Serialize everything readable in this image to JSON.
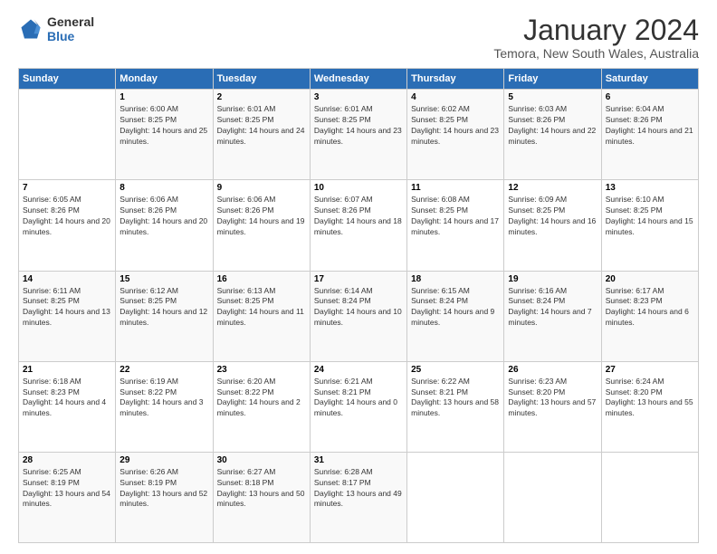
{
  "logo": {
    "general": "General",
    "blue": "Blue"
  },
  "title": "January 2024",
  "location": "Temora, New South Wales, Australia",
  "days_of_week": [
    "Sunday",
    "Monday",
    "Tuesday",
    "Wednesday",
    "Thursday",
    "Friday",
    "Saturday"
  ],
  "weeks": [
    [
      {
        "day": "",
        "empty": true
      },
      {
        "day": "1",
        "sunrise": "6:00 AM",
        "sunset": "8:25 PM",
        "daylight": "14 hours and 25 minutes."
      },
      {
        "day": "2",
        "sunrise": "6:01 AM",
        "sunset": "8:25 PM",
        "daylight": "14 hours and 24 minutes."
      },
      {
        "day": "3",
        "sunrise": "6:01 AM",
        "sunset": "8:25 PM",
        "daylight": "14 hours and 23 minutes."
      },
      {
        "day": "4",
        "sunrise": "6:02 AM",
        "sunset": "8:25 PM",
        "daylight": "14 hours and 23 minutes."
      },
      {
        "day": "5",
        "sunrise": "6:03 AM",
        "sunset": "8:26 PM",
        "daylight": "14 hours and 22 minutes."
      },
      {
        "day": "6",
        "sunrise": "6:04 AM",
        "sunset": "8:26 PM",
        "daylight": "14 hours and 21 minutes."
      }
    ],
    [
      {
        "day": "7",
        "sunrise": "6:05 AM",
        "sunset": "8:26 PM",
        "daylight": "14 hours and 20 minutes."
      },
      {
        "day": "8",
        "sunrise": "6:06 AM",
        "sunset": "8:26 PM",
        "daylight": "14 hours and 20 minutes."
      },
      {
        "day": "9",
        "sunrise": "6:06 AM",
        "sunset": "8:26 PM",
        "daylight": "14 hours and 19 minutes."
      },
      {
        "day": "10",
        "sunrise": "6:07 AM",
        "sunset": "8:26 PM",
        "daylight": "14 hours and 18 minutes."
      },
      {
        "day": "11",
        "sunrise": "6:08 AM",
        "sunset": "8:25 PM",
        "daylight": "14 hours and 17 minutes."
      },
      {
        "day": "12",
        "sunrise": "6:09 AM",
        "sunset": "8:25 PM",
        "daylight": "14 hours and 16 minutes."
      },
      {
        "day": "13",
        "sunrise": "6:10 AM",
        "sunset": "8:25 PM",
        "daylight": "14 hours and 15 minutes."
      }
    ],
    [
      {
        "day": "14",
        "sunrise": "6:11 AM",
        "sunset": "8:25 PM",
        "daylight": "14 hours and 13 minutes."
      },
      {
        "day": "15",
        "sunrise": "6:12 AM",
        "sunset": "8:25 PM",
        "daylight": "14 hours and 12 minutes."
      },
      {
        "day": "16",
        "sunrise": "6:13 AM",
        "sunset": "8:25 PM",
        "daylight": "14 hours and 11 minutes."
      },
      {
        "day": "17",
        "sunrise": "6:14 AM",
        "sunset": "8:24 PM",
        "daylight": "14 hours and 10 minutes."
      },
      {
        "day": "18",
        "sunrise": "6:15 AM",
        "sunset": "8:24 PM",
        "daylight": "14 hours and 9 minutes."
      },
      {
        "day": "19",
        "sunrise": "6:16 AM",
        "sunset": "8:24 PM",
        "daylight": "14 hours and 7 minutes."
      },
      {
        "day": "20",
        "sunrise": "6:17 AM",
        "sunset": "8:23 PM",
        "daylight": "14 hours and 6 minutes."
      }
    ],
    [
      {
        "day": "21",
        "sunrise": "6:18 AM",
        "sunset": "8:23 PM",
        "daylight": "14 hours and 4 minutes."
      },
      {
        "day": "22",
        "sunrise": "6:19 AM",
        "sunset": "8:22 PM",
        "daylight": "14 hours and 3 minutes."
      },
      {
        "day": "23",
        "sunrise": "6:20 AM",
        "sunset": "8:22 PM",
        "daylight": "14 hours and 2 minutes."
      },
      {
        "day": "24",
        "sunrise": "6:21 AM",
        "sunset": "8:21 PM",
        "daylight": "14 hours and 0 minutes."
      },
      {
        "day": "25",
        "sunrise": "6:22 AM",
        "sunset": "8:21 PM",
        "daylight": "13 hours and 58 minutes."
      },
      {
        "day": "26",
        "sunrise": "6:23 AM",
        "sunset": "8:20 PM",
        "daylight": "13 hours and 57 minutes."
      },
      {
        "day": "27",
        "sunrise": "6:24 AM",
        "sunset": "8:20 PM",
        "daylight": "13 hours and 55 minutes."
      }
    ],
    [
      {
        "day": "28",
        "sunrise": "6:25 AM",
        "sunset": "8:19 PM",
        "daylight": "13 hours and 54 minutes."
      },
      {
        "day": "29",
        "sunrise": "6:26 AM",
        "sunset": "8:19 PM",
        "daylight": "13 hours and 52 minutes."
      },
      {
        "day": "30",
        "sunrise": "6:27 AM",
        "sunset": "8:18 PM",
        "daylight": "13 hours and 50 minutes."
      },
      {
        "day": "31",
        "sunrise": "6:28 AM",
        "sunset": "8:17 PM",
        "daylight": "13 hours and 49 minutes."
      },
      {
        "day": "",
        "empty": true
      },
      {
        "day": "",
        "empty": true
      },
      {
        "day": "",
        "empty": true
      }
    ]
  ],
  "labels": {
    "sunrise_prefix": "Sunrise: ",
    "sunset_prefix": "Sunset: ",
    "daylight_prefix": "Daylight: "
  }
}
